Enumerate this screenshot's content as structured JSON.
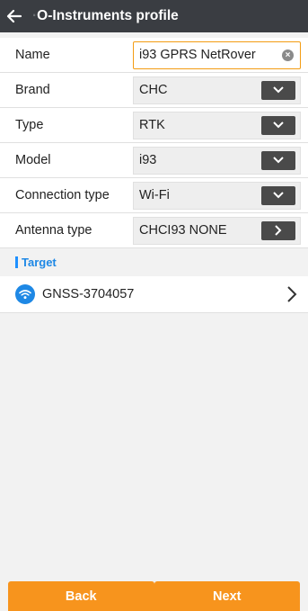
{
  "header": {
    "title_faded": "·",
    "title": "O-Instruments profile"
  },
  "form": {
    "name": {
      "label": "Name",
      "value": "i93 GPRS NetRover"
    },
    "brand": {
      "label": "Brand",
      "value": "CHC"
    },
    "type": {
      "label": "Type",
      "value": "RTK"
    },
    "model": {
      "label": "Model",
      "value": "i93"
    },
    "connection_type": {
      "label": "Connection type",
      "value": "Wi-Fi"
    },
    "antenna_type": {
      "label": "Antenna type",
      "value": "CHCI93 NONE"
    }
  },
  "target": {
    "section_title": "Target",
    "device_name": "GNSS-3704057"
  },
  "footer": {
    "back_label": "Back",
    "next_label": "Next"
  },
  "colors": {
    "appbar": "#3a3d42",
    "accent_orange": "#f7941d",
    "accent_blue": "#1e88e5"
  }
}
